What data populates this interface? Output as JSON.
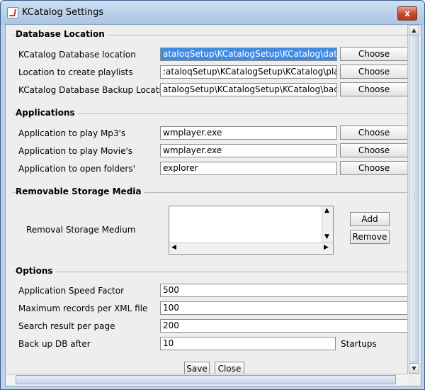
{
  "window": {
    "title": "KCatalog Settings",
    "close_label": "x"
  },
  "sections": {
    "database": {
      "title": "Database Location",
      "rows": [
        {
          "label": "KCatalog Database location",
          "value": "ataloqSetup\\KCatalogSetup\\KCatalog\\database",
          "button": "Choose"
        },
        {
          "label": "Location to create playlists",
          "value": ":ataloqSetup\\KCatalogSetup\\KCatalog\\playlist",
          "button": "Choose"
        },
        {
          "label": "KCatalog Database Backup Location",
          "value": "atalogSetup\\KCatalogSetup\\KCatalog\\backup",
          "button": "Choose"
        }
      ]
    },
    "applications": {
      "title": "Applications",
      "rows": [
        {
          "label": "Application to play Mp3's",
          "value": "wmplayer.exe",
          "button": "Choose"
        },
        {
          "label": "Application to play Movie's",
          "value": "wmplayer.exe",
          "button": "Choose"
        },
        {
          "label": "Application to open folders'",
          "value": "explorer",
          "button": "Choose"
        }
      ]
    },
    "removable": {
      "title": "Removable Storage Media",
      "label": "Removal Storage Medium",
      "add_label": "Add",
      "remove_label": "Remove"
    },
    "options": {
      "title": "Options",
      "rows": [
        {
          "label": "Application Speed Factor",
          "value": "500"
        },
        {
          "label": "Maximum records per XML file",
          "value": "100"
        },
        {
          "label": "Search result per page",
          "value": "200"
        },
        {
          "label": "Back up DB after",
          "value": "10",
          "suffix": "Startups"
        }
      ]
    }
  },
  "footer": {
    "save_label": "Save",
    "close_label": "Close"
  },
  "icons": {
    "scroll_up": "▲",
    "scroll_down": "▼",
    "scroll_left": "◀",
    "scroll_right": "▶",
    "grip": "⋮"
  }
}
